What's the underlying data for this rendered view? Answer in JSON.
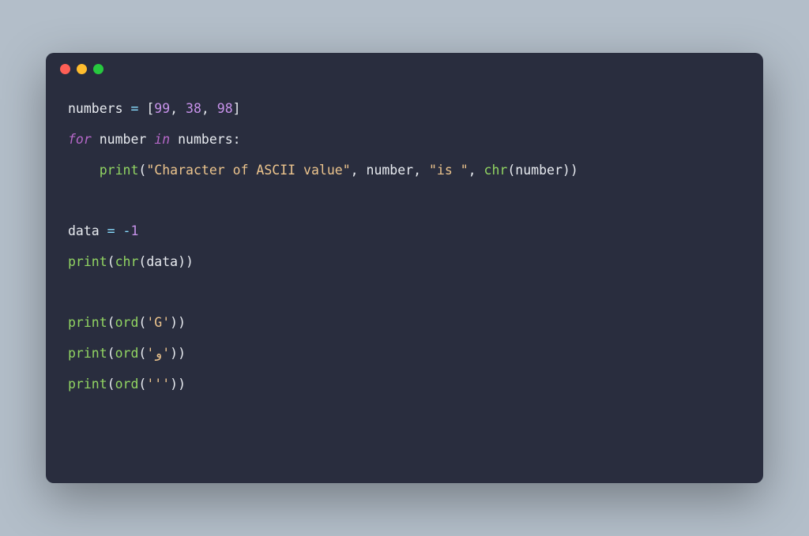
{
  "window": {
    "dots": [
      "red",
      "yellow",
      "green"
    ]
  },
  "code": {
    "tokens": [
      [
        {
          "t": "numbers ",
          "c": "tok-default"
        },
        {
          "t": "=",
          "c": "tok-op"
        },
        {
          "t": " [",
          "c": "tok-punc"
        },
        {
          "t": "99",
          "c": "tok-num"
        },
        {
          "t": ", ",
          "c": "tok-punc"
        },
        {
          "t": "38",
          "c": "tok-num"
        },
        {
          "t": ", ",
          "c": "tok-punc"
        },
        {
          "t": "98",
          "c": "tok-num"
        },
        {
          "t": "]",
          "c": "tok-punc"
        }
      ],
      [
        {
          "t": "for",
          "c": "tok-for"
        },
        {
          "t": " number ",
          "c": "tok-default"
        },
        {
          "t": "in",
          "c": "tok-for"
        },
        {
          "t": " numbers:",
          "c": "tok-default"
        }
      ],
      [
        {
          "t": "    ",
          "c": "tok-default"
        },
        {
          "t": "print",
          "c": "tok-builtin"
        },
        {
          "t": "(",
          "c": "tok-punc"
        },
        {
          "t": "\"Character of ASCII value\"",
          "c": "tok-string"
        },
        {
          "t": ", number, ",
          "c": "tok-default"
        },
        {
          "t": "\"is \"",
          "c": "tok-string"
        },
        {
          "t": ", ",
          "c": "tok-default"
        },
        {
          "t": "chr",
          "c": "tok-builtin"
        },
        {
          "t": "(number))",
          "c": "tok-punc"
        }
      ],
      [],
      [
        {
          "t": "data ",
          "c": "tok-default"
        },
        {
          "t": "=",
          "c": "tok-op"
        },
        {
          "t": " ",
          "c": "tok-default"
        },
        {
          "t": "-",
          "c": "tok-op"
        },
        {
          "t": "1",
          "c": "tok-num"
        }
      ],
      [
        {
          "t": "print",
          "c": "tok-builtin"
        },
        {
          "t": "(",
          "c": "tok-punc"
        },
        {
          "t": "chr",
          "c": "tok-builtin"
        },
        {
          "t": "(data))",
          "c": "tok-punc"
        }
      ],
      [],
      [
        {
          "t": "print",
          "c": "tok-builtin"
        },
        {
          "t": "(",
          "c": "tok-punc"
        },
        {
          "t": "ord",
          "c": "tok-builtin"
        },
        {
          "t": "(",
          "c": "tok-punc"
        },
        {
          "t": "'G'",
          "c": "tok-string"
        },
        {
          "t": "))",
          "c": "tok-punc"
        }
      ],
      [
        {
          "t": "print",
          "c": "tok-builtin"
        },
        {
          "t": "(",
          "c": "tok-punc"
        },
        {
          "t": "ord",
          "c": "tok-builtin"
        },
        {
          "t": "(",
          "c": "tok-punc"
        },
        {
          "t": "'و'",
          "c": "tok-string"
        },
        {
          "t": "))",
          "c": "tok-punc"
        }
      ],
      [
        {
          "t": "print",
          "c": "tok-builtin"
        },
        {
          "t": "(",
          "c": "tok-punc"
        },
        {
          "t": "ord",
          "c": "tok-builtin"
        },
        {
          "t": "(",
          "c": "tok-punc"
        },
        {
          "t": "'''",
          "c": "tok-string"
        },
        {
          "t": "))",
          "c": "tok-punc"
        }
      ]
    ]
  }
}
